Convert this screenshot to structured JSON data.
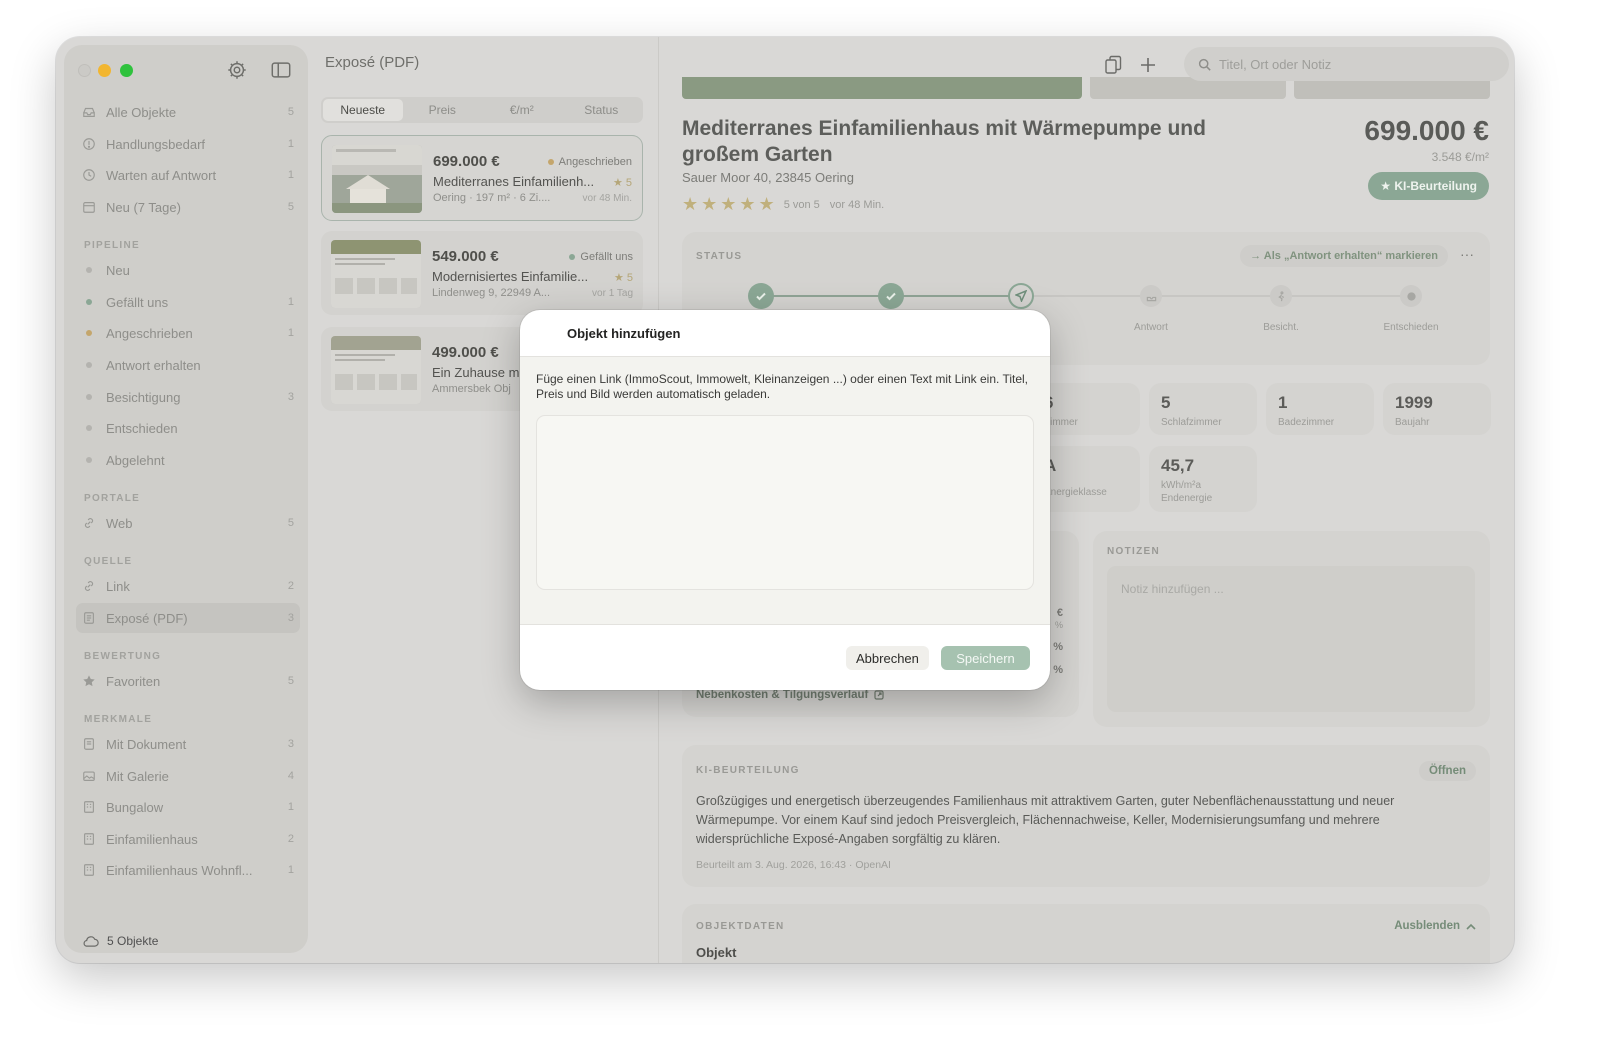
{
  "sidebar": {
    "items": [
      {
        "label": "Alle Objekte",
        "count": "5",
        "icon": "tray-icon"
      },
      {
        "label": "Handlungsbedarf",
        "count": "1",
        "icon": "exclamation-circle-icon"
      },
      {
        "label": "Warten auf Antwort",
        "count": "1",
        "icon": "clock-icon"
      },
      {
        "label": "Neu (7 Tage)",
        "count": "5",
        "icon": "calendar-icon"
      }
    ],
    "sections": {
      "pipeline": "PIPELINE",
      "portale": "PORTALE",
      "quelle": "QUELLE",
      "bewertung": "BEWERTUNG",
      "merkmale": "MERKMALE"
    },
    "pipeline": [
      {
        "label": "Neu",
        "count": "",
        "color": "#b4b3af"
      },
      {
        "label": "Gefällt uns",
        "count": "1",
        "color": "#8ba795"
      },
      {
        "label": "Angeschrieben",
        "count": "1",
        "color": "#c4a66c"
      },
      {
        "label": "Antwort erhalten",
        "count": "",
        "color": "#b4b3af"
      },
      {
        "label": "Besichtigung",
        "count": "3",
        "color": "#b4b3af"
      },
      {
        "label": "Entschieden",
        "count": "",
        "color": "#b4b3af"
      },
      {
        "label": "Abgelehnt",
        "count": "",
        "color": "#b4b3af"
      }
    ],
    "portale": [
      {
        "label": "Web",
        "count": "5",
        "icon": "link-icon"
      }
    ],
    "quelle": [
      {
        "label": "Link",
        "count": "2",
        "icon": "link-icon"
      },
      {
        "label": "Exposé (PDF)",
        "count": "3",
        "icon": "document-icon"
      }
    ],
    "bewertung": [
      {
        "label": "Favoriten",
        "count": "5",
        "icon": "star-icon"
      }
    ],
    "merkmale": [
      {
        "label": "Mit Dokument",
        "count": "3",
        "icon": "document-icon"
      },
      {
        "label": "Mit Galerie",
        "count": "4",
        "icon": "gallery-icon"
      },
      {
        "label": "Bungalow",
        "count": "1",
        "icon": "building-icon"
      },
      {
        "label": "Einfamilienhaus",
        "count": "2",
        "icon": "building-icon"
      },
      {
        "label": "Einfamilienhaus Wohnfl...",
        "count": "1",
        "icon": "building-icon"
      }
    ],
    "footer": "5 Objekte"
  },
  "list": {
    "title": "Exposé (PDF)",
    "sort_tabs": [
      "Neueste",
      "Preis",
      "€/m²",
      "Status"
    ],
    "cards": [
      {
        "price": "699.000 €",
        "status": "Angeschrieben",
        "status_color": "#c4a66c",
        "title": "Mediterranes Einfamilienh...",
        "rating": "★ 5",
        "sub": "Oering · 197 m² · 6 Zi....",
        "time": "vor 48 Min."
      },
      {
        "price": "549.000 €",
        "status": "Gefällt uns",
        "status_color": "#8ba795",
        "title": "Modernisiertes Einfamilie...",
        "rating": "★ 5",
        "sub": "Lindenweg 9, 22949 A...",
        "time": "vor 1 Tag"
      },
      {
        "price": "499.000 €",
        "status": "",
        "status_color": "#b4b3af",
        "title": "Ein Zuhause m",
        "rating": "",
        "sub": "Ammersbek Obj",
        "time": ""
      }
    ]
  },
  "toolbar": {
    "search_placeholder": "Titel, Ort oder Notiz"
  },
  "detail": {
    "title": "Mediterranes Einfamilienhaus mit Wärmepumpe und großem Garten",
    "address": "Sauer Moor 40, 23845 Oering",
    "stars": "★★★★★",
    "rating_text": "5 von 5",
    "time": "vor 48 Min.",
    "price": "699.000 €",
    "price_per_sqm": "3.548 €/m²",
    "ki_button": "★ KI-Beurteilung",
    "status": {
      "label": "STATUS",
      "action": "→ Als „Antwort erhalten“ markieren",
      "more": "···",
      "steps": [
        {
          "label": ""
        },
        {
          "label": ""
        },
        {
          "label": ""
        },
        {
          "label": "Antwort"
        },
        {
          "label": "Besicht."
        },
        {
          "label": "Entschieden"
        }
      ]
    },
    "facts": [
      {
        "value": "6",
        "label": "Zimmer"
      },
      {
        "value": "5",
        "label": "Schlafzimmer"
      },
      {
        "value": "1",
        "label": "Badezimmer"
      },
      {
        "value": "1999",
        "label": "Baujahr"
      },
      {
        "value": "A",
        "label": "Energieklasse"
      },
      {
        "value": "45,7",
        "label": "kWh/m²a Endenergie"
      }
    ],
    "finance_link": "Nebenkosten & Tilgungsverlauf",
    "finance_partials": [
      "€",
      "%",
      "%",
      "%"
    ],
    "notes": {
      "label": "NOTIZEN",
      "placeholder": "Notiz hinzufügen ..."
    },
    "ki": {
      "label": "KI-BEURTEILUNG",
      "open": "Öffnen",
      "text": "Großzügiges und energetisch überzeugendes Familienhaus mit attraktivem Garten, guter Nebenflächenausstattung und neuer Wärmepumpe. Vor einem Kauf sind jedoch Preisvergleich, Flächennachweise, Keller, Modernisierungsumfang und mehrere widersprüchliche Exposé-Angaben sorgfältig zu klären.",
      "meta": "Beurteilt am 3. Aug. 2026, 16:43 · OpenAI"
    },
    "objektdaten": {
      "label": "OBJEKTDATEN",
      "hide": "Ausblenden",
      "first": "Objekt"
    }
  },
  "modal": {
    "title": "Objekt hinzufügen",
    "description": "Füge einen Link (ImmoScout, Immowelt, Kleinanzeigen ...) oder einen Text mit Link ein. Titel, Preis und Bild werden automatisch geladen.",
    "text_value": "",
    "cancel": "Abbrechen",
    "save": "Speichern"
  }
}
